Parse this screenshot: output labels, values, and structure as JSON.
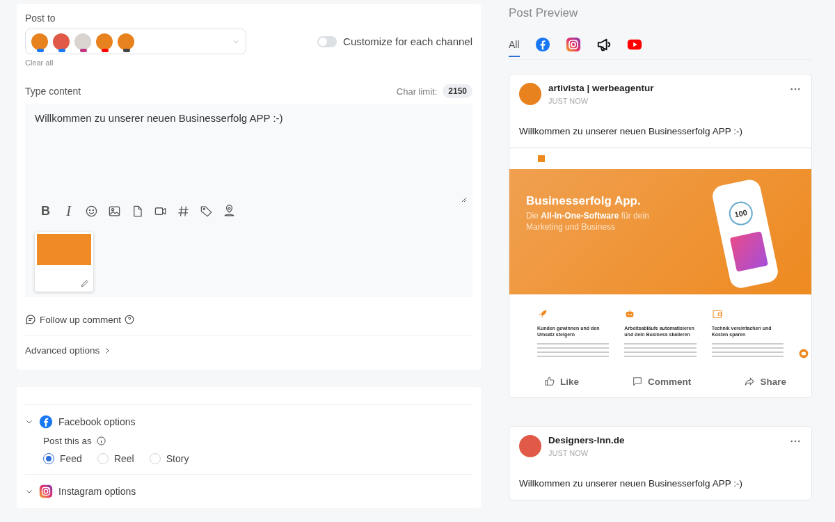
{
  "composer": {
    "post_to_label": "Post to",
    "channels": [
      {
        "color": "#e8821e",
        "kind": "facebook"
      },
      {
        "color": "#e05a47",
        "kind": "facebook"
      },
      {
        "color": "#d9d4cf",
        "kind": "instagram"
      },
      {
        "color": "#e8821e",
        "kind": "youtube"
      },
      {
        "color": "#e8821e",
        "kind": "business"
      }
    ],
    "clear_all": "Clear all",
    "customize": {
      "label": "Customize for each channel",
      "on": false
    },
    "content_label": "Type content",
    "char_limit_label": "Char limit:",
    "char_limit": "2150",
    "text": "Willkommen zu unserer neuen Businesserfolg APP :-)",
    "toolbar": [
      {
        "kind": "bold",
        "label": "B"
      },
      {
        "kind": "italic",
        "label": "I"
      },
      {
        "kind": "emoji"
      },
      {
        "kind": "image"
      },
      {
        "kind": "file"
      },
      {
        "kind": "video"
      },
      {
        "kind": "hashtag"
      },
      {
        "kind": "tag"
      },
      {
        "kind": "location"
      }
    ],
    "follow_up": "Follow up comment",
    "advanced": "Advanced options"
  },
  "options": [
    {
      "kind": "facebook",
      "title": "Facebook options",
      "expanded": true,
      "post_as_label": "Post this as",
      "choices": [
        {
          "label": "Feed",
          "selected": true
        },
        {
          "label": "Reel",
          "selected": false
        },
        {
          "label": "Story",
          "selected": false
        }
      ]
    },
    {
      "kind": "instagram",
      "title": "Instagram options",
      "expanded": true
    }
  ],
  "preview": {
    "title": "Post Preview",
    "tabs": [
      {
        "kind": "all",
        "label": "All",
        "selected": true
      },
      {
        "kind": "facebook",
        "selected": false
      },
      {
        "kind": "instagram",
        "selected": false
      },
      {
        "kind": "megaphone",
        "selected": false
      },
      {
        "kind": "youtube",
        "selected": false
      }
    ],
    "posts": [
      {
        "author": "artivista | werbeagentur",
        "time": "JUST NOW",
        "color": "#e8821e",
        "text": "Willkommen zu unserer neuen Businesserfolg APP :-)",
        "site": {
          "hero_title": "Businesserfolg App.",
          "hero_subtitle": "Die **All-In-One-Software** für dein Marketing und Business",
          "score": "100",
          "features": [
            {
              "kind": "rocket",
              "title": "Kunden gewinnen und den Umsatz steigern"
            },
            {
              "kind": "robot",
              "title": "Arbeitsabläufe automatisieren und dein Business skalieren"
            },
            {
              "kind": "wallet",
              "title": "Technik vereinfachen und Kosten sparen"
            }
          ]
        },
        "actions": [
          {
            "kind": "like",
            "label": "Like"
          },
          {
            "kind": "comment",
            "label": "Comment"
          },
          {
            "kind": "share",
            "label": "Share"
          }
        ]
      },
      {
        "author": "Designers-Inn.de",
        "time": "JUST NOW",
        "color": "#e05a47",
        "text": "Willkommen zu unserer neuen Businesserfolg APP :-)"
      }
    ]
  }
}
